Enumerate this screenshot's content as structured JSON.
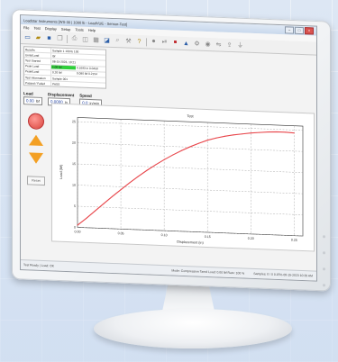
{
  "window": {
    "title": "Loadstar Instruments [WS-30 | 1000 lb - LoadVUE - Sensor-Test]",
    "buttons": [
      "–",
      "□",
      "×"
    ]
  },
  "menu": [
    "File",
    "Test",
    "Display",
    "Setup",
    "Tools",
    "Help"
  ],
  "toolbar_icons": [
    "new-file",
    "open-folder",
    "save",
    "copy",
    "print",
    "preview",
    "table",
    "chart",
    "zoom",
    "tools",
    "help",
    "record",
    "play",
    "stop",
    "run",
    "settings",
    "sensor",
    "connect",
    "export",
    "filter"
  ],
  "info_table": [
    {
      "key": "Results",
      "val": "Sample 1    100 lb    100"
    },
    {
      "key": "Units/Load",
      "val": "lbf"
    },
    {
      "key": "Test Started",
      "val": "08-15-2023, 10:21"
    },
    {
      "key": "Peak Load",
      "val": "1.00 lbf",
      "style": "green",
      "extra": "0.1093 in  0.0450"
    },
    {
      "key": "Peak/Load",
      "val": "0.20 lbf",
      "extra": "0.090 lbf  0.2154"
    },
    {
      "key": "Test Information",
      "val": "Sample 001"
    },
    {
      "key": "Passed / Failed",
      "val": "PASS"
    }
  ],
  "readouts": {
    "load": {
      "label": "Load",
      "value": "0.00",
      "unit": "lbf"
    },
    "displacement": {
      "label": "Displacement",
      "value": "0.0000",
      "unit": "in"
    },
    "speed": {
      "label": "Speed",
      "value": "0.0",
      "unit": "in/min"
    }
  },
  "controls": {
    "reset": "Reset"
  },
  "chart_data": {
    "type": "line",
    "title": "Test",
    "xlabel": "Displacement (in)",
    "ylabel": "Load (lbf)",
    "xlim": [
      0.0,
      0.26
    ],
    "ylim": [
      0.0,
      26.0
    ],
    "x_ticks": [
      "0.00",
      "0.05",
      "0.10",
      "0.15",
      "0.20",
      "0.25"
    ],
    "y_ticks": [
      "0",
      "5",
      "10",
      "15",
      "20",
      "25"
    ],
    "grid": true,
    "series": [
      {
        "color": "#e8454a",
        "x": [
          0.0,
          0.01,
          0.02,
          0.03,
          0.04,
          0.05,
          0.06,
          0.07,
          0.08,
          0.09,
          0.1,
          0.11,
          0.12,
          0.13,
          0.14,
          0.15,
          0.16,
          0.17,
          0.18,
          0.19,
          0.2,
          0.21,
          0.22,
          0.23,
          0.24,
          0.25
        ],
        "y": [
          0.5,
          2.2,
          4.0,
          5.8,
          7.6,
          9.3,
          11.0,
          12.6,
          14.1,
          15.5,
          16.8,
          18.0,
          19.1,
          20.1,
          21.0,
          21.8,
          22.4,
          22.9,
          23.3,
          23.6,
          23.9,
          24.1,
          24.3,
          24.4,
          24.4,
          24.3
        ]
      }
    ]
  },
  "status": {
    "left": "Test Ready | Load: OK",
    "mid": "Mode: Compression   Tared Load: 0.00 lbf   Rate: 100 %",
    "right": "Samples: 0 / 0   0.15%   08-15-2023  10:35 AM"
  }
}
